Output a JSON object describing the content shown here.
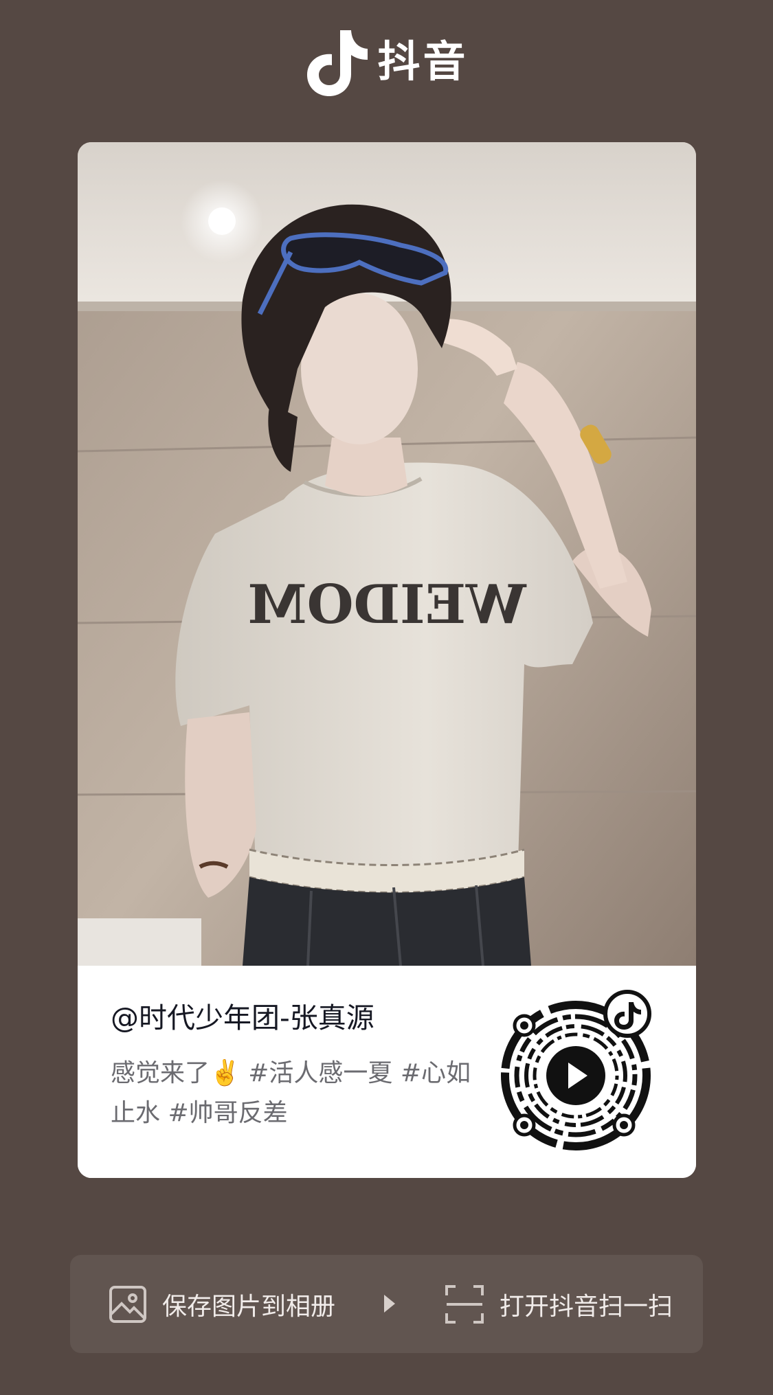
{
  "brand": {
    "name": "抖音",
    "logo_icon": "douyin-note-icon"
  },
  "post": {
    "author": "@时代少年团-张真源",
    "caption": "感觉来了✌️ #活人感一夏 #心如止水 #帅哥反差",
    "shirt_text": "WEIDOM"
  },
  "qr": {
    "center_icon": "play-icon",
    "corner_icon": "douyin-note-icon"
  },
  "actions": {
    "save_label": "保存图片到相册",
    "save_icon": "image-icon",
    "scan_label": "打开抖音扫一扫",
    "scan_icon": "scan-icon",
    "divider_icon": "triangle-right-icon"
  },
  "colors": {
    "background": "#554843",
    "action_bar": "#615550",
    "text_primary": "#161823",
    "text_secondary": "#6b6b70"
  }
}
